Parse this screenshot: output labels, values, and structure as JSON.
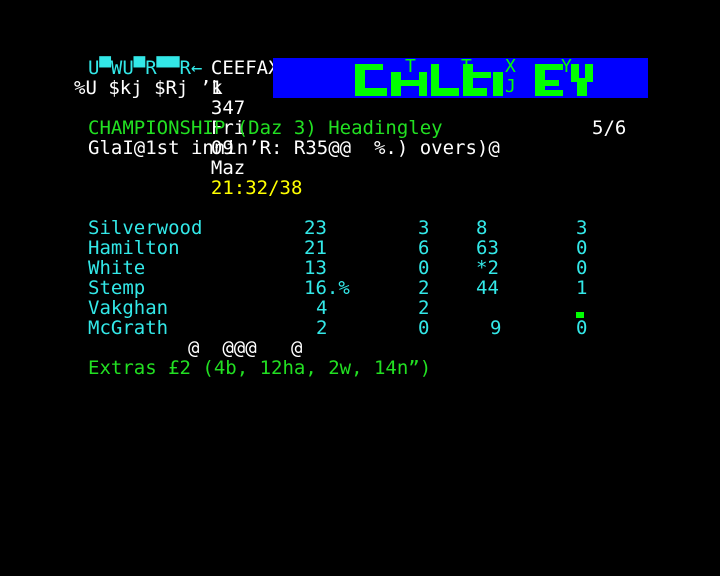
{
  "header": {
    "service": "CEEFAX",
    "magazine": "1",
    "page_number": "347",
    "day": "Fri",
    "date": "09",
    "month": "Maz",
    "time": "21:32/38"
  },
  "logo": {
    "left_line1": "U▀WU▀R▀▀R←",
    "left_line2": "%U $kj $Rj ’k",
    "mosaic_letters": [
      "T",
      "T",
      "X",
      "Y",
      "J"
    ]
  },
  "title": {
    "heading": "CHAMPIONSHIP (Daz 3) Headingley",
    "page_indicator": "5/6",
    "subheading": "GlaI@1st innin’R: R35@@  %.) overs)@"
  },
  "bowling": [
    {
      "name": "Silverwood",
      "overs": "23",
      "maidens": "3",
      "runs": "8",
      "wickets": "3"
    },
    {
      "name": "Hamilton",
      "overs": "21",
      "maidens": "6",
      "runs": "63",
      "wickets": "0"
    },
    {
      "name": "White",
      "overs": "13",
      "maidens": "0",
      "runs": "*2",
      "wickets": "0"
    },
    {
      "name": "Stemp",
      "overs": "16.%",
      "maidens": "2",
      "runs": "44",
      "wickets": "1"
    },
    {
      "name": "Vakghan",
      "overs": "4",
      "maidens": "2",
      "runs": "",
      "wickets": ""
    },
    {
      "name": "McGrath",
      "overs": "2",
      "maidens": "0",
      "runs": "9",
      "wickets": "0"
    }
  ],
  "noise_line": "@  @@@   @",
  "extras": "Extras £2 (4b, 12ha, 2w, 14n”)",
  "colors": {
    "background": "#000000",
    "header_text": "#ffffff",
    "clock": "#ffff00",
    "cyan": "#33e8e8",
    "green": "#22e022",
    "banner": "#0000ff"
  }
}
